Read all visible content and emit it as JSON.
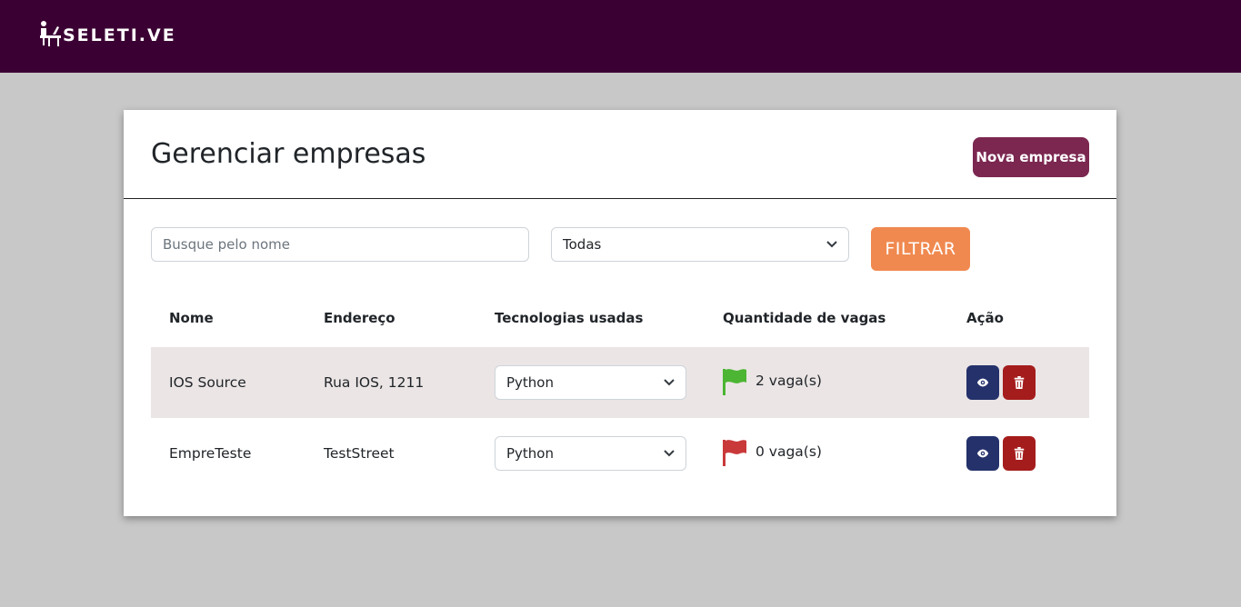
{
  "header": {
    "brand": "SELETI.VE"
  },
  "page": {
    "title": "Gerenciar empresas",
    "new_button": "Nova empresa"
  },
  "filters": {
    "search_placeholder": "Busque pelo nome",
    "status_selected": "Todas",
    "filter_button": "FILTRAR"
  },
  "table": {
    "headers": [
      "Nome",
      "Endereço",
      "Tecnologias usadas",
      "Quantidade de vagas",
      "Ação"
    ],
    "rows": [
      {
        "nome": "IOS Source",
        "endereco": "Rua IOS, 1211",
        "tecnologia": "Python",
        "vagas": "2 vaga(s)",
        "flag_color": "#4cb533"
      },
      {
        "nome": "EmpreTeste",
        "endereco": "TestStreet",
        "tecnologia": "Python",
        "vagas": "0 vaga(s)",
        "flag_color": "#c9393a"
      }
    ]
  },
  "icons": {
    "logo": "desk-person-icon",
    "view": "eye-icon",
    "delete": "trash-icon",
    "dropdown": "chevron-down-icon",
    "status": "flag-icon"
  },
  "colors": {
    "topbar": "#3b0033",
    "primary_button": "#7b2750",
    "filter_button": "#f0894f",
    "view_button": "#24316b",
    "delete_button": "#a51c1c",
    "row_highlight": "#ebe5e5"
  }
}
